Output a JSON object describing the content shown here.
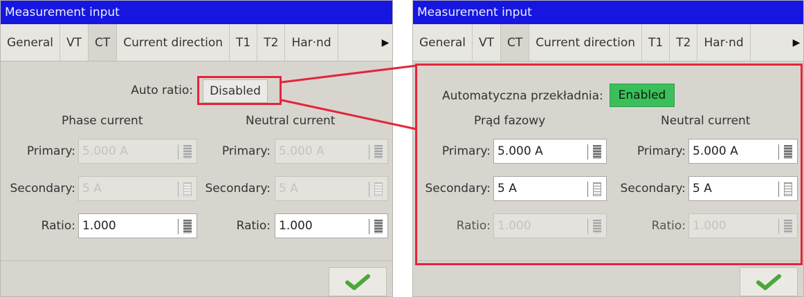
{
  "left": {
    "title": "Measurement input",
    "tabs": [
      "General",
      "VT",
      "CT",
      "Current direction",
      "T1",
      "T2",
      "Har·nd"
    ],
    "auto_ratio_label": "Auto ratio:",
    "auto_ratio_value": "Disabled",
    "phase_heading": "Phase current",
    "neutral_heading": "Neutral current",
    "phase": {
      "primary_label": "Primary:",
      "primary_value": "5.000 A",
      "secondary_label": "Secondary:",
      "secondary_value": "5 A",
      "ratio_label": "Ratio:",
      "ratio_value": "1.000"
    },
    "neutral": {
      "primary_label": "Primary:",
      "primary_value": "5.000 A",
      "secondary_label": "Secondary:",
      "secondary_value": "5 A",
      "ratio_label": "Ratio:",
      "ratio_value": "1.000"
    }
  },
  "right": {
    "title": "Measurement input",
    "tabs": [
      "General",
      "VT",
      "CT",
      "Current direction",
      "T1",
      "T2",
      "Har·nd"
    ],
    "auto_ratio_label": "Automatyczna przekładnia:",
    "auto_ratio_value": "Enabled",
    "phase_heading": "Prąd fazowy",
    "neutral_heading": "Neutral current",
    "phase": {
      "primary_label": "Primary:",
      "primary_value": "5.000 A",
      "secondary_label": "Secondary:",
      "secondary_value": "5 A",
      "ratio_label": "Ratio:",
      "ratio_value": "1.000"
    },
    "neutral": {
      "primary_label": "Primary:",
      "primary_value": "5.000 A",
      "secondary_label": "Secondary:",
      "secondary_value": "5 A",
      "ratio_label": "Ratio:",
      "ratio_value": "1.000"
    }
  },
  "colors": {
    "titlebar": "#1616e0",
    "enabled_toggle": "#3bbf5b",
    "highlight": "#e4243a",
    "checkmark": "#4aa838"
  },
  "icons": {
    "spinner": "stepper-icon",
    "list": "list-icon",
    "ok": "checkmark-icon",
    "tab_scroll": "arrow-right-icon"
  }
}
